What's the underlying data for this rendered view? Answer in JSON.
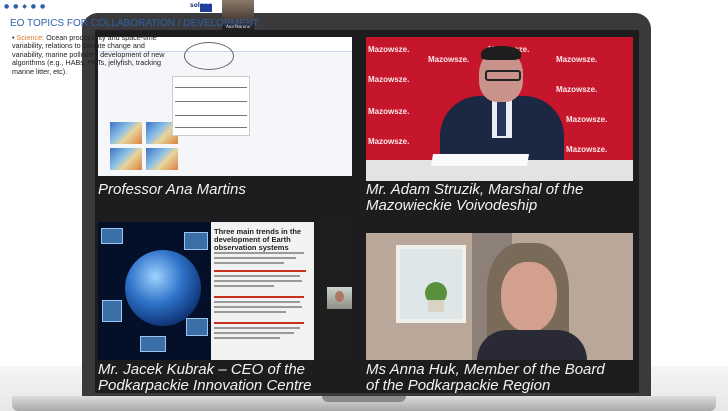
{
  "captions": {
    "tile1": "Professor Ana Martins",
    "tile2_line1": "Mr. Adam Struzik, Marshal of the",
    "tile2_line2": "Mazowieckie Voivodeship",
    "tile3_line1": "Mr. Jacek Kubrak – CEO of the",
    "tile3_line2": "Podkarpackie Innovation Centre",
    "tile4_line1": "Ms Anna Huk, Member of the Board",
    "tile4_line2": "of the Podkarpackie Region"
  },
  "slide1": {
    "title": "EO TOPICS FOR COLLABORATION / DEVELOPMENT",
    "bullet_label": "Science:",
    "bullet_text": "Ocean productivity and space-time variability, relations to climate change and variability, marine pollution, development of new algorithms (e.g., HABs, PFTs, jellyfish, tracking marine litter, etc).",
    "speaker_thumb": "Ana Martins",
    "logo_text": "solgeo"
  },
  "tile2": {
    "backdrop_word": "Mazowsze."
  },
  "slide3": {
    "title": "Three main trends in the development of Earth observation systems"
  },
  "colors": {
    "frame": "#3a3a3c",
    "screen": "#1d1d1f",
    "red_backdrop": "#c5162c",
    "slide_title": "#2f5fa8"
  }
}
